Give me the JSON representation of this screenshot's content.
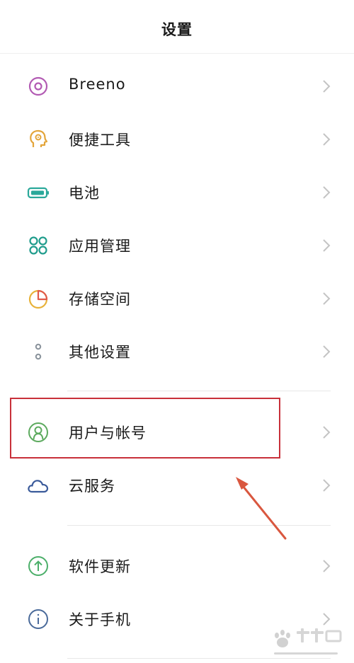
{
  "header": {
    "title": "设置"
  },
  "items": [
    {
      "label": "Breeno",
      "icon": "breeno-icon"
    },
    {
      "label": "便捷工具",
      "icon": "quick-tools-icon"
    },
    {
      "label": "电池",
      "icon": "battery-icon"
    },
    {
      "label": "应用管理",
      "icon": "app-management-icon"
    },
    {
      "label": "存储空间",
      "icon": "storage-icon"
    },
    {
      "label": "其他设置",
      "icon": "more-settings-icon"
    },
    {
      "label": "用户与帐号",
      "icon": "user-account-icon"
    },
    {
      "label": "云服务",
      "icon": "cloud-icon"
    },
    {
      "label": "软件更新",
      "icon": "software-update-icon"
    },
    {
      "label": "关于手机",
      "icon": "about-phone-icon"
    }
  ],
  "colors": {
    "highlight": "#c8303a",
    "arrow": "#d9573f",
    "chevron": "#c4c4c4"
  },
  "watermark": {
    "icon": "baidu-jingyan-logo",
    "text": "Baidu经验 jingyan.baidu.com"
  }
}
